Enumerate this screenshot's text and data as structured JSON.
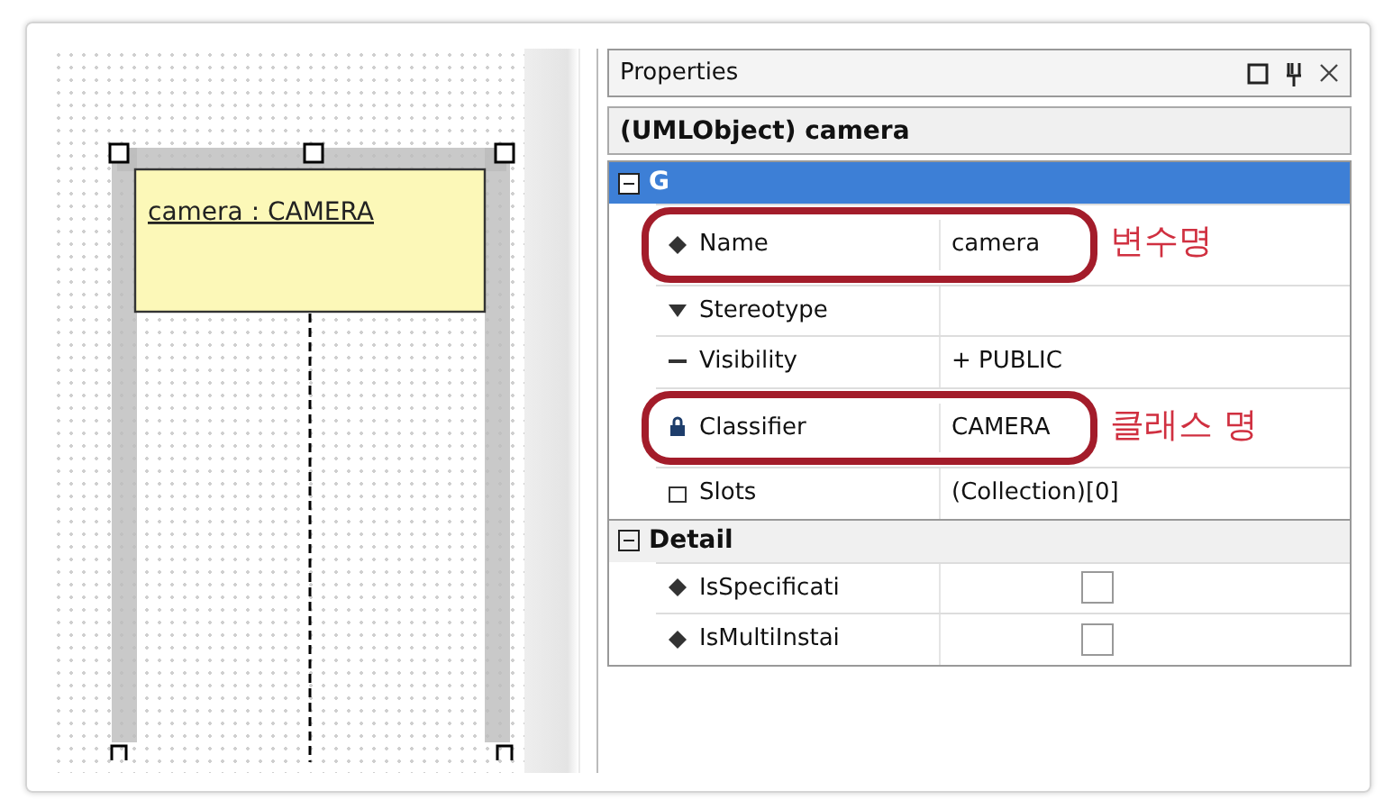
{
  "diagram": {
    "object_label": "camera : CAMERA",
    "selected": true
  },
  "properties_panel": {
    "title": "Properties",
    "header": "(UMLObject) camera",
    "groups": [
      {
        "label": "G",
        "expanded": true,
        "selected": true,
        "rows": [
          {
            "kind": "text",
            "name": "Name",
            "value": "camera",
            "annotation": "변수명"
          },
          {
            "kind": "text",
            "name": "Stereotype"
          },
          {
            "kind": "text",
            "name": "Visibility",
            "value": "+ PUBLIC"
          },
          {
            "kind": "text",
            "name": "Classifier",
            "value": "CAMERA",
            "annotation": "클래스 명"
          },
          {
            "kind": "text",
            "name": "Slots",
            "value": "(Collection)[0]"
          }
        ]
      },
      {
        "label": "Detail",
        "expanded": true,
        "selected": false,
        "rows": [
          {
            "kind": "checkbox",
            "name": "IsSpecificati",
            "checked": false
          },
          {
            "kind": "checkbox",
            "name": "IsMultiInstai",
            "checked": false
          }
        ]
      }
    ]
  }
}
